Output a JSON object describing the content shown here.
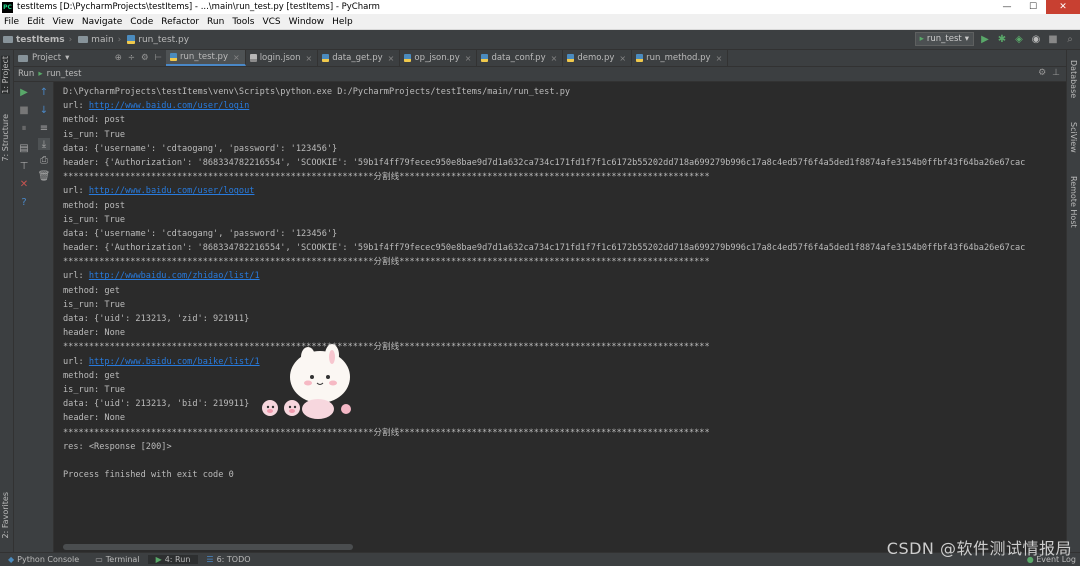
{
  "window": {
    "title": "testItems [D:\\PycharmProjects\\testItems] - ...\\main\\run_test.py [testItems] - PyCharm",
    "app_icon": "PC",
    "min": "—",
    "max": "☐",
    "close": "✕"
  },
  "menu": [
    "File",
    "Edit",
    "View",
    "Navigate",
    "Code",
    "Refactor",
    "Run",
    "Tools",
    "VCS",
    "Window",
    "Help"
  ],
  "breadcrumb": {
    "project": "testItems",
    "folder": "main",
    "file": "run_test.py"
  },
  "run_config": "run_test",
  "project_panel": {
    "label": "Project"
  },
  "tabs": [
    "run_test.py",
    "login.json",
    "data_get.py",
    "op_json.py",
    "data_conf.py",
    "demo.py",
    "run_method.py"
  ],
  "left_stripe": {
    "project": "1: Project",
    "structure": "7: Structure",
    "favorites": "2: Favorites"
  },
  "right_stripe": {
    "database": "Database",
    "sciview": "SciView",
    "remote": "Remote Host"
  },
  "run_header": {
    "label": "Run",
    "config": "run_test"
  },
  "console": {
    "lines": [
      {
        "t": "D:\\PycharmProjects\\testItems\\venv\\Scripts\\python.exe D:/PycharmProjects/testItems/main/run_test.py"
      },
      {
        "p": "url: ",
        "link": "http://www.baidu.com/user/login"
      },
      {
        "t": "method: post"
      },
      {
        "t": "is_run: True"
      },
      {
        "t": "data: {'username': 'cdtaogang', 'password': '123456'}"
      },
      {
        "t": "header: {'Authorization': '868334782216554', 'SCOOKIE': '59b1f4ff79fecec950e8bae9d7d1a632ca734c171fd1f7f1c6172b55202dd718a699279b996c17a8c4ed57f6f4a5ded1f8874afe3154b0ffbf43f64ba26e67cac"
      },
      {
        "t": "************************************************************分割线************************************************************"
      },
      {
        "p": "url: ",
        "link": "http://www.baidu.com/user/logout"
      },
      {
        "t": "method: post"
      },
      {
        "t": "is_run: True"
      },
      {
        "t": "data: {'username': 'cdtaogang', 'password': '123456'}"
      },
      {
        "t": "header: {'Authorization': '868334782216554', 'SCOOKIE': '59b1f4ff79fecec950e8bae9d7d1a632ca734c171fd1f7f1c6172b55202dd718a699279b996c17a8c4ed57f6f4a5ded1f8874afe3154b0ffbf43f64ba26e67cac"
      },
      {
        "t": "************************************************************分割线************************************************************"
      },
      {
        "p": "url: ",
        "link": "http://wwwbaidu.com/zhidao/list/1"
      },
      {
        "t": "method: get"
      },
      {
        "t": "is_run: True"
      },
      {
        "t": "data: {'uid': 213213, 'zid': 921911}"
      },
      {
        "t": "header: None"
      },
      {
        "t": "************************************************************分割线************************************************************"
      },
      {
        "p": "url: ",
        "link": "http://www.baidu.com/baike/list/1"
      },
      {
        "t": "method: get"
      },
      {
        "t": "is_run: True"
      },
      {
        "t": "data: {'uid': 213213, 'bid': 219911}"
      },
      {
        "t": "header: None"
      },
      {
        "t": "************************************************************分割线************************************************************"
      },
      {
        "t": "res: <Response [200]>"
      },
      {
        "t": ""
      },
      {
        "t": "Process finished with exit code 0"
      }
    ]
  },
  "status_bar": {
    "python_console": "Python Console",
    "terminal": "Terminal",
    "run": "4: Run",
    "todo": "6: TODO",
    "event_log": "Event Log"
  },
  "watermark": "CSDN @软件测试情报局",
  "colors": {
    "accent": "#4a88c7",
    "link": "#287bde",
    "run_green": "#59a869",
    "stop_red": "#c75450"
  }
}
